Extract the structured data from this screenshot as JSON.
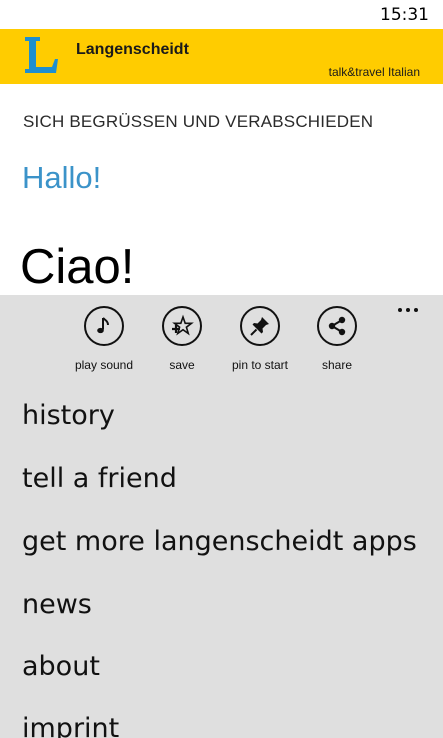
{
  "status_bar": {
    "time": "15:31"
  },
  "brand": {
    "name": "Langenscheidt",
    "tagline": "talk&travel Italian",
    "logo_letter": "L",
    "colors": {
      "banner": "#ffcc00",
      "logo": "#1e8fcf"
    }
  },
  "content": {
    "category": "SICH BEGRÜSSEN UND VERABSCHIEDEN",
    "source_phrase": "Hallo!",
    "target_phrase": "Ciao!",
    "colors": {
      "source_phrase": "#3b93c9"
    }
  },
  "app_bar": {
    "buttons": [
      {
        "label": "play sound",
        "icon": "music-note-icon"
      },
      {
        "label": "save",
        "icon": "star-add-icon"
      },
      {
        "label": "pin to start",
        "icon": "pin-icon"
      },
      {
        "label": "share",
        "icon": "share-icon"
      }
    ],
    "menu_items": [
      "history",
      "tell a friend",
      "get more langenscheidt apps",
      "news",
      "about",
      "imprint"
    ],
    "background": "#dfdfdf"
  }
}
